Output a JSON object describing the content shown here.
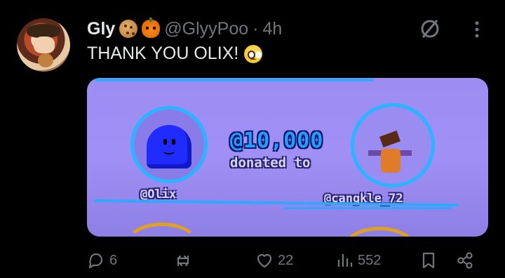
{
  "tweet": {
    "name": "Gly",
    "emojis": [
      "cookie-emoji",
      "pumpkin-emoji"
    ],
    "handle": "@GlyyPoo",
    "separator": "·",
    "time": "4h",
    "text": "THANK YOU OLIX!",
    "text_emoji": "pleading-face-emoji"
  },
  "media": {
    "amount": "@10,000",
    "donated_label": "donated to",
    "from_user": "@Olix",
    "to_user": "@cangkle_72"
  },
  "actions": {
    "replies": "6",
    "reposts": "",
    "likes": "22",
    "views": "552"
  },
  "colors": {
    "background": "#000000",
    "text": "#e7e9ea",
    "muted": "#71767b",
    "media_bg": "#9d8df2",
    "accent_blue": "#2fa8ff"
  }
}
